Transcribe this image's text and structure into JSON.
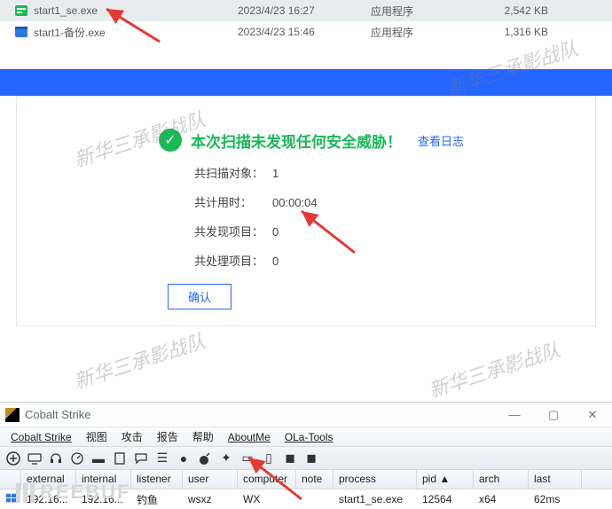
{
  "files": [
    {
      "name": "start1_se.exe",
      "date": "2023/4/23 16:27",
      "type": "应用程序",
      "size": "2,542 KB"
    },
    {
      "name": "start1-备份.exe",
      "date": "2023/4/23 15:46",
      "type": "应用程序",
      "size": "1,316 KB"
    }
  ],
  "scan": {
    "title": "本次扫描未发现任何安全威胁！",
    "view_log": "查看日志",
    "rows": {
      "scanned": {
        "label": "共扫描对象：",
        "value": "1"
      },
      "elapsed": {
        "label": "共计用时：",
        "value": "00:00:04"
      },
      "found": {
        "label": "共发现项目：",
        "value": "0"
      },
      "handled": {
        "label": "共处理项目：",
        "value": "0"
      }
    },
    "confirm": "确认"
  },
  "cs": {
    "title": "Cobalt Strike",
    "menu": [
      "Cobalt Strike",
      "视图",
      "攻击",
      "报告",
      "帮助",
      "AboutMe",
      "OLa-Tools"
    ],
    "headers": {
      "external": "external",
      "internal": "internal",
      "listener": "listener",
      "user": "user",
      "computer": "computer",
      "note": "note",
      "process": "process",
      "pid": "pid ▲",
      "arch": "arch",
      "last": "last"
    },
    "row": {
      "external": "192.16...",
      "internal": "192.16...",
      "listener": "钓鱼",
      "user": "wsxz",
      "computer": "WX",
      "note": "",
      "process": "start1_se.exe",
      "pid": "12564",
      "arch": "x64",
      "last": "62ms"
    }
  },
  "watermark": "新华三承影战队",
  "freebuf": "REEBUF"
}
